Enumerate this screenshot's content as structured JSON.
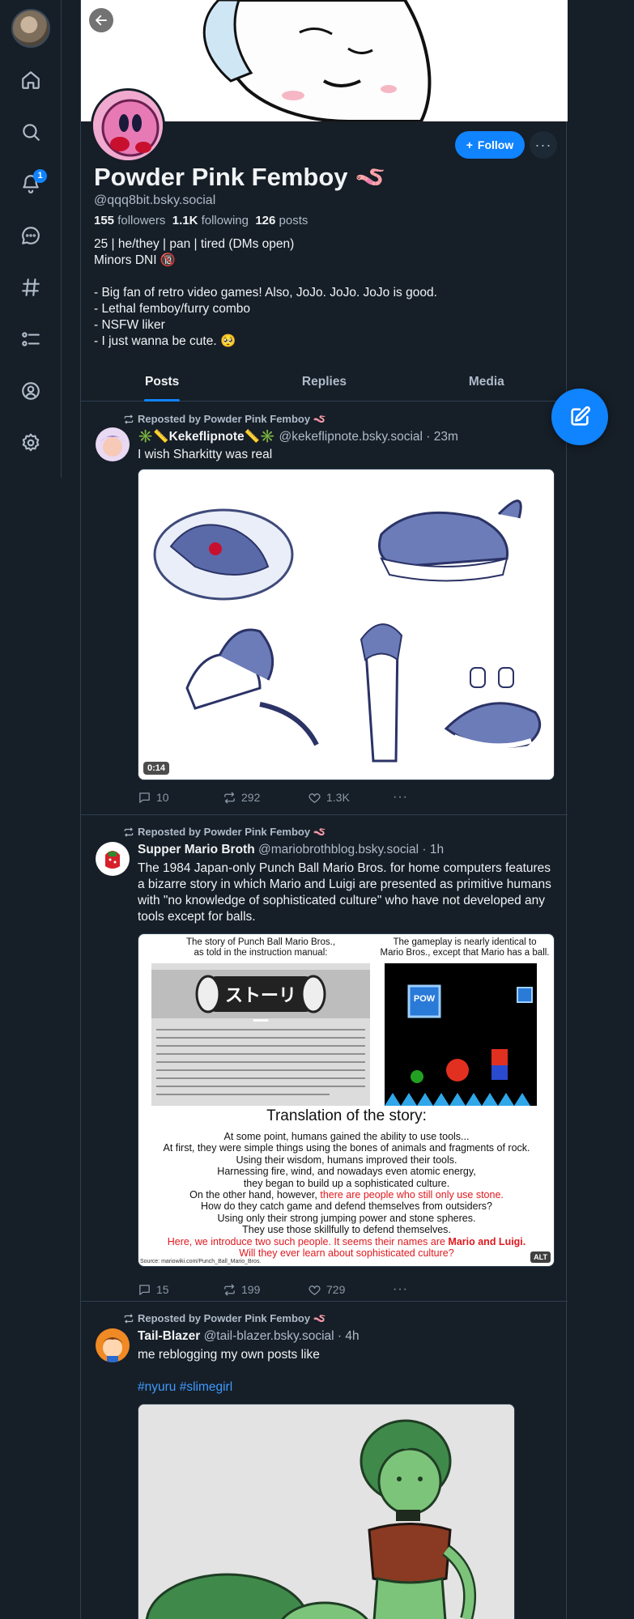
{
  "nav": {
    "notification_count": "1",
    "items": [
      "home",
      "search",
      "notifications",
      "chat",
      "feeds",
      "lists",
      "profile",
      "settings"
    ]
  },
  "profile": {
    "display_name": "Powder Pink Femboy",
    "name_emoji": "🪱",
    "handle": "@qqq8bit.bsky.social",
    "followers_count": "155",
    "followers_label": "followers",
    "following_count": "1.1K",
    "following_label": "following",
    "posts_count": "126",
    "posts_label": "posts",
    "follow_label": "Follow",
    "more_label": "···",
    "bio": "25 | he/they | pan | tired (DMs open)\nMinors DNI 🔞\n\n- Big fan of retro video games! Also, JoJo. JoJo. JoJo is good.\n- Lethal femboy/furry combo\n- NSFW liker\n- I just wanna be cute. 🥺"
  },
  "tabs": [
    {
      "label": "Posts",
      "active": true
    },
    {
      "label": "Replies",
      "active": false
    },
    {
      "label": "Media",
      "active": false
    }
  ],
  "posts": [
    {
      "repost_label": "Reposted by Powder Pink Femboy 🪱",
      "author": "✳️📏Kekeflipnote📏✳️",
      "handle": "@kekeflipnote.bsky.social",
      "time": "· 23m",
      "text": "I wish Sharkitty was real",
      "video_duration": "0:14",
      "replies": "10",
      "reposts": "292",
      "likes": "1.3K"
    },
    {
      "repost_label": "Reposted by Powder Pink Femboy 🪱",
      "author": "Supper Mario Broth",
      "handle": "@mariobrothblog.bsky.social",
      "time": "· 1h",
      "text": "The 1984 Japan-only Punch Ball Mario Bros. for home computers features a bizarre story in which Mario and Luigi are presented as primitive humans with \"no knowledge of sophisticated culture\" who have not developed any tools except for balls.",
      "image": {
        "caption_left": "The story of Punch Ball Mario Bros.,\nas told in the instruction manual:",
        "caption_right": "The gameplay is nearly identical to\nMario Bros., except that Mario has a ball.",
        "manual_heading": "ストーリー",
        "pow": "POW",
        "translation_title": "Translation of the story:",
        "body_1": "At some point, humans gained the ability to use tools...\nAt first, they were simple things using the bones of animals and fragments of rock.\nUsing their wisdom, humans improved their tools.\nHarnessing fire, wind, and nowadays even atomic energy,\nthey began to build up a sophisticated culture.\nOn the other hand, however, ",
        "body_red_1": "there are people who still only use stone.",
        "body_2": "\nHow do they catch game and defend themselves from outsiders?\nUsing only their strong jumping power and stone spheres.\nThey use those skillfully to defend themselves.\n",
        "body_red_2": "Here, we introduce two such people. It seems their names are ",
        "body_red_bold": "Mario and Luigi.",
        "body_red_3": "\nWill they ever learn about sophisticated culture?",
        "source": "Source: mariowiki.com/Punch_Ball_Mario_Bros.",
        "alt": "ALT"
      },
      "replies": "15",
      "reposts": "199",
      "likes": "729"
    },
    {
      "repost_label": "Reposted by Powder Pink Femboy 🪱",
      "author": "Tail-Blazer",
      "handle": "@tail-blazer.bsky.social",
      "time": "· 4h",
      "text": "me reblogging my own posts like",
      "tags": "#nyuru #slimegirl"
    }
  ],
  "colors": {
    "background": "#161e27",
    "accent": "#1083fe",
    "border": "#2e4052",
    "muted": "#aebbc9",
    "red_text": "#e0181e"
  }
}
